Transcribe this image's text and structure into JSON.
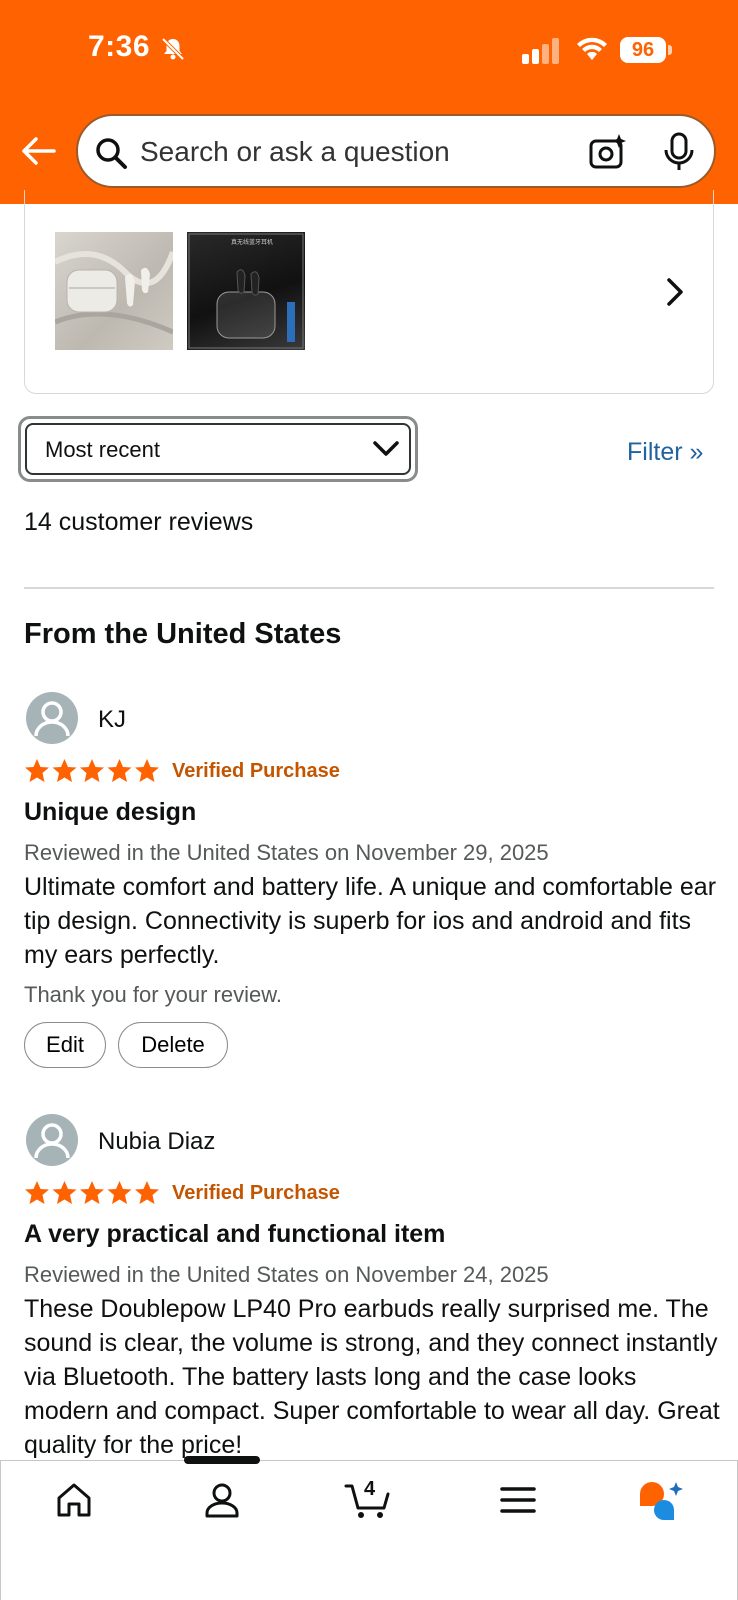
{
  "status_bar": {
    "time": "7:36",
    "battery": "96"
  },
  "search": {
    "placeholder": "Search or ask a question"
  },
  "sort": {
    "selected": "Most recent"
  },
  "filter_label": "Filter »",
  "review_count": "14 customer reviews",
  "region_heading": "From the United States",
  "reviews": [
    {
      "name": "KJ",
      "stars": 5,
      "verified": "Verified Purchase",
      "title": "Unique design",
      "date": "Reviewed in the United States on November 29, 2025",
      "body": "Ultimate comfort and battery life. A unique and comfortable ear tip design. Connectivity is superb for ios and android and fits my ears perfectly.",
      "thanks": "Thank you for your review.",
      "edit_label": "Edit",
      "delete_label": "Delete"
    },
    {
      "name": "Nubia Diaz",
      "stars": 5,
      "verified": "Verified Purchase",
      "title": "A very practical and functional item",
      "date": "Reviewed in the United States on November 24, 2025",
      "body": "These Doublepow LP40 Pro earbuds really surprised me. The sound is clear, the volume is strong, and they connect instantly via Bluetooth. The battery lasts long and the case looks modern and compact. Super comfortable to wear all day. Great quality for the price!"
    }
  ],
  "tab_bar": {
    "cart_count": "4",
    "tabs": [
      "home-icon",
      "account-icon",
      "cart-icon",
      "menu-icon",
      "rufus-icon"
    ]
  },
  "colors": {
    "header": "#FF6200",
    "link": "#2162A1",
    "verified": "#C45500",
    "star": "#FF6200"
  }
}
